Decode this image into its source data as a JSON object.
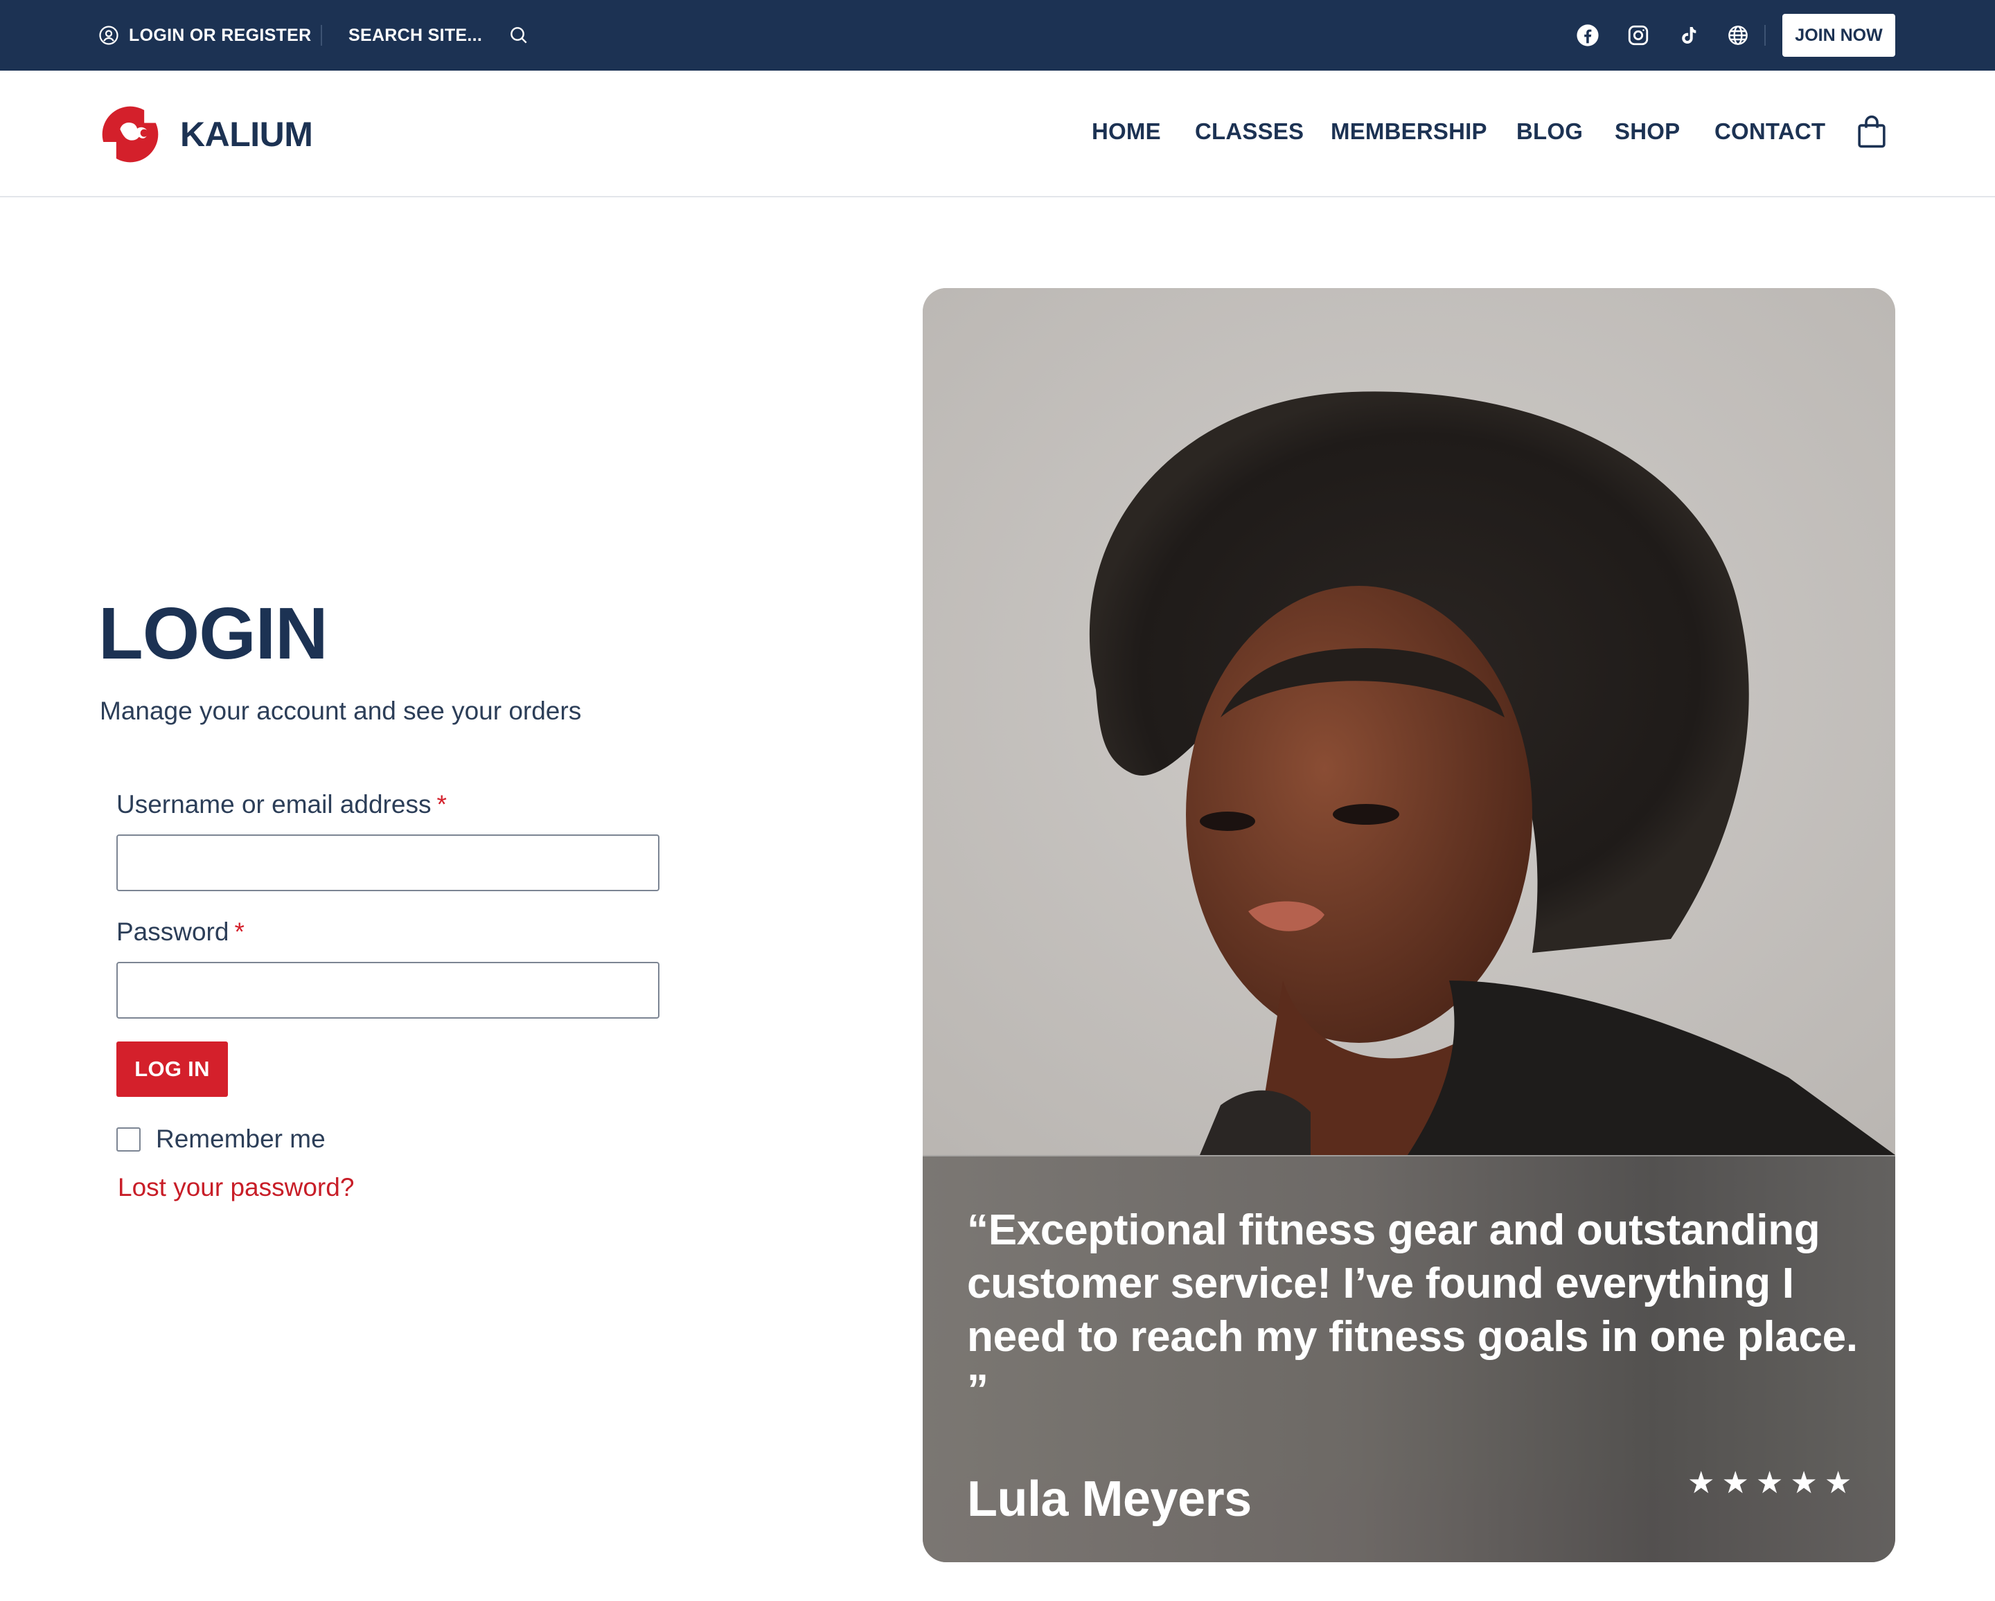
{
  "topbar": {
    "login_label": "LOGIN OR REGISTER",
    "search_label": "SEARCH SITE...",
    "social_icons": [
      "facebook-icon",
      "instagram-icon",
      "tiktok-icon",
      "globe-icon"
    ],
    "join_label": "JOIN NOW"
  },
  "header": {
    "brand": "KALIUM",
    "nav": [
      "HOME",
      "CLASSES",
      "MEMBERSHIP",
      "BLOG",
      "SHOP",
      "CONTACT"
    ]
  },
  "login": {
    "title": "LOGIN",
    "subtitle": "Manage your account and see your orders",
    "username_label": "Username or email address",
    "password_label": "Password",
    "required_marker": "*",
    "username_value": "",
    "password_value": "",
    "button_label": "LOG IN",
    "remember_label": "Remember me",
    "remember_checked": false,
    "lost_password": "Lost your password?"
  },
  "testimonial": {
    "quote": "“Exceptional fitness gear and outstanding customer service! I’ve found everything I need to reach my fitness goals in one place. ”",
    "author": "Lula Meyers",
    "rating": 5
  },
  "colors": {
    "navy": "#1c3253",
    "accent_red": "#d4202b",
    "link_red": "#c81e28",
    "white": "#ffffff"
  }
}
